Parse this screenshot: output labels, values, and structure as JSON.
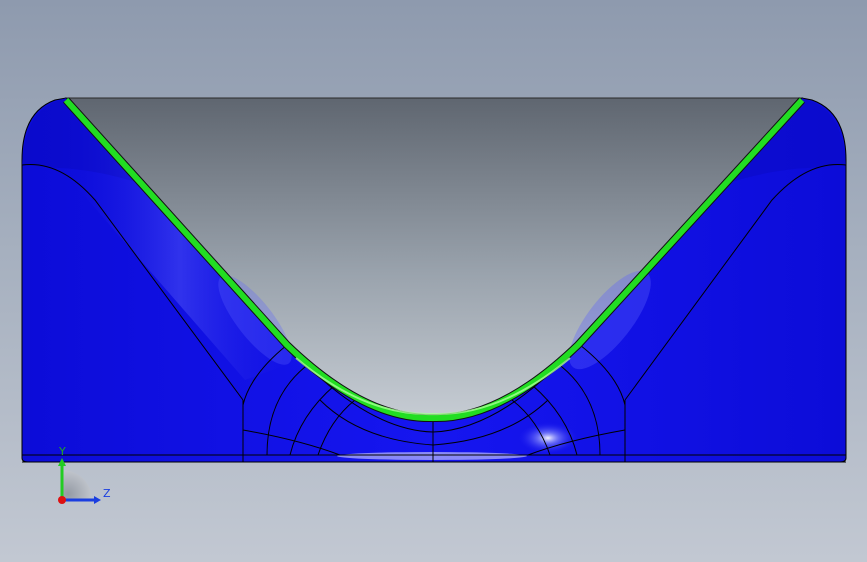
{
  "viewport": {
    "background_top": "#8e9aae",
    "background_bottom": "#c2c8d2"
  },
  "model": {
    "body_color": "#1010e8",
    "highlight_color": "#ffffff",
    "selected_edge_color": "#22dd22",
    "pocket_shade_top": "#6a7078",
    "pocket_shade_bottom": "#c2c8d0"
  },
  "triad": {
    "y_label": "Y",
    "z_label": "Z",
    "y_color": "#22cc22",
    "z_color": "#1a3ee0",
    "x_color": "#dd1111"
  }
}
